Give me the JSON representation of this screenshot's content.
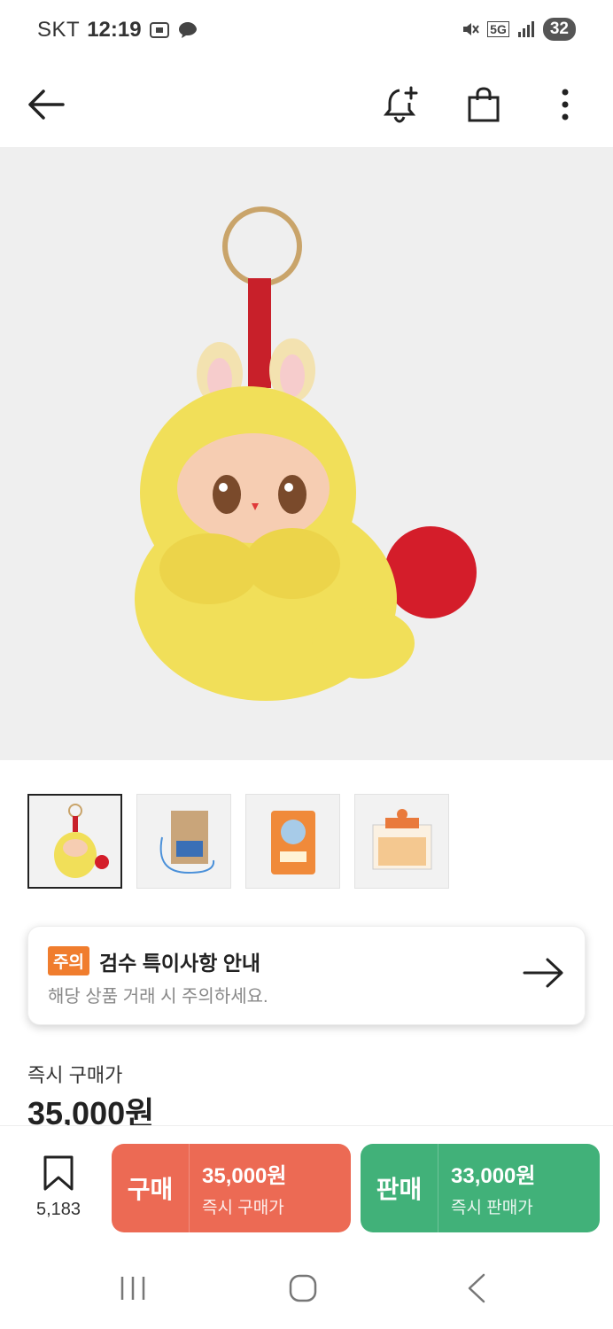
{
  "status_bar": {
    "carrier": "SKT",
    "time": "12:19",
    "network": "5G",
    "battery": "32"
  },
  "app_bar": {
    "icons": [
      "back-arrow-icon",
      "bell-plus-icon",
      "shopping-bag-icon",
      "more-vertical-icon"
    ]
  },
  "product": {
    "thumbnails": [
      "keychain-plush-front",
      "paper-bag-package",
      "snack-pouch-package",
      "display-box-package"
    ],
    "selected_thumbnail": 0
  },
  "notice": {
    "badge": "주의",
    "title": "검수 특이사항 안내",
    "subtitle": "해당 상품 거래 시 주의하세요."
  },
  "price": {
    "label": "즉시 구매가",
    "value": "35,000원"
  },
  "action_bar": {
    "bookmark_count": "5,183",
    "buy": {
      "label": "구매",
      "amount": "35,000원",
      "desc": "즉시 구매가"
    },
    "sell": {
      "label": "판매",
      "amount": "33,000원",
      "desc": "즉시 판매가"
    }
  },
  "colors": {
    "buy": "#ec6a54",
    "sell": "#41b179",
    "notice_badge": "#f07d2e"
  }
}
